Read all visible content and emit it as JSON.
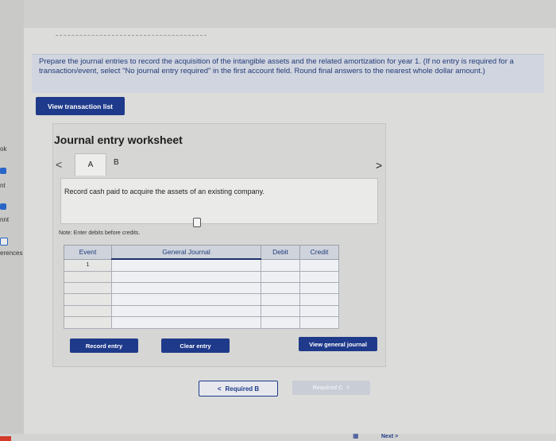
{
  "sidebar": {
    "items": [
      {
        "label": "ok"
      },
      {
        "label": "nt"
      },
      {
        "label": "nnt"
      },
      {
        "label": "erences"
      }
    ]
  },
  "prompt": {
    "text": "Prepare the journal entries to record the acquisition of the intangible assets and the related amortization for year 1. (If no entry is required for a transaction/event, select \"No journal entry required\" in the first account field. Round final answers to the nearest whole dollar amount.)"
  },
  "buttons": {
    "view_transaction_list": "View transaction list",
    "record_entry": "Record entry",
    "clear_entry": "Clear entry",
    "view_general_journal": "View general journal"
  },
  "worksheet": {
    "title": "Journal entry worksheet",
    "tabs": [
      {
        "label": "A"
      },
      {
        "label": "B"
      }
    ],
    "prev_icon": "<",
    "next_icon": ">",
    "description": "Record cash paid to acquire the assets of an existing company.",
    "note": "Note: Enter debits before credits."
  },
  "journal": {
    "columns": [
      "Event",
      "General Journal",
      "Debit",
      "Credit"
    ],
    "rows": [
      {
        "event": "1",
        "account": "",
        "debit": "",
        "credit": ""
      },
      {
        "event": "",
        "account": "",
        "debit": "",
        "credit": ""
      },
      {
        "event": "",
        "account": "",
        "debit": "",
        "credit": ""
      },
      {
        "event": "",
        "account": "",
        "debit": "",
        "credit": ""
      },
      {
        "event": "",
        "account": "",
        "debit": "",
        "credit": ""
      },
      {
        "event": "",
        "account": "",
        "debit": "",
        "credit": ""
      }
    ]
  },
  "navigation": {
    "prev_label": "Required B",
    "next_label": "Required C",
    "footer_next": "Next"
  },
  "colors": {
    "accent": "#1f3a8a",
    "prompt_text": "#243a78",
    "disabled_button": "#c9cdd6"
  }
}
